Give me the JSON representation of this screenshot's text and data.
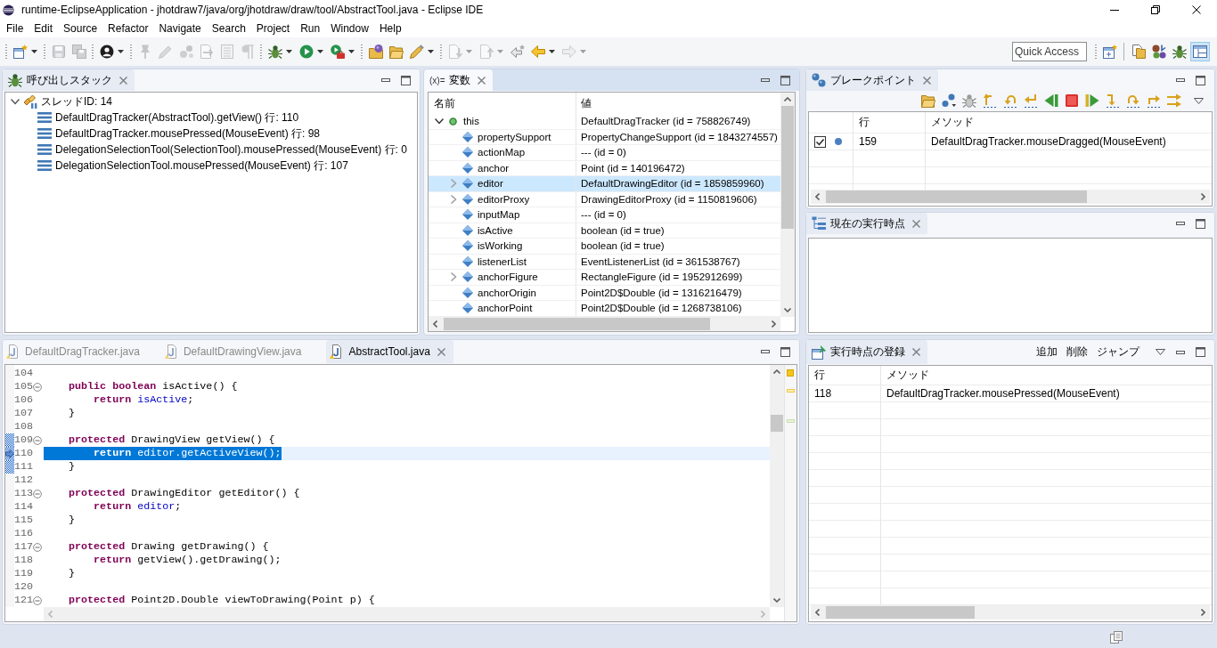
{
  "window": {
    "title": "runtime-EclipseApplication - jhotdraw7/java/org/jhotdraw/draw/tool/AbstractTool.java - Eclipse IDE"
  },
  "menu": [
    "File",
    "Edit",
    "Source",
    "Refactor",
    "Navigate",
    "Search",
    "Project",
    "Run",
    "Window",
    "Help"
  ],
  "toolbar": {
    "groups": [
      [
        {
          "disabled": false,
          "dropdown": true
        }
      ],
      [
        {
          "disabled": true,
          "dropdown": false
        },
        {
          "disabled": true,
          "dropdown": false
        }
      ],
      [
        {
          "disabled": false,
          "dropdown": true
        }
      ],
      [
        {
          "disabled": true,
          "dropdown": false
        },
        {
          "disabled": true,
          "dropdown": false
        },
        {
          "disabled": true,
          "dropdown": false
        },
        {
          "disabled": true,
          "dropdown": false
        },
        {
          "disabled": true,
          "dropdown": false
        },
        {
          "disabled": true,
          "dropdown": false
        }
      ],
      [
        {
          "disabled": false,
          "dropdown": true
        },
        {
          "disabled": false,
          "dropdown": true
        },
        {
          "disabled": false,
          "dropdown": true
        }
      ],
      [
        {
          "disabled": false,
          "dropdown": false
        },
        {
          "disabled": false,
          "dropdown": false
        },
        {
          "disabled": false,
          "dropdown": true
        }
      ],
      [
        {
          "disabled": true,
          "dropdown": true
        },
        {
          "disabled": true,
          "dropdown": true
        },
        {
          "disabled": false,
          "dropdown": false
        },
        {
          "disabled": false,
          "dropdown": true
        },
        {
          "disabled": true,
          "dropdown": true
        }
      ]
    ],
    "quick_access": {
      "placeholder": "Quick Access"
    },
    "perspectives": [
      {
        "selected": false
      },
      {
        "selected": false
      },
      {
        "selected": false
      },
      {
        "selected": true
      }
    ]
  },
  "call_stack": {
    "focused": false,
    "tab": {
      "title": "呼び出しスタック"
    },
    "tree": [
      {
        "label": "スレッドID: 14",
        "expanded": true,
        "children": [
          {
            "label": "DefaultDragTracker(AbstractTool).getView() 行: 110"
          },
          {
            "label": "DefaultDragTracker.mousePressed(MouseEvent) 行: 98"
          },
          {
            "label": "DelegationSelectionTool(SelectionTool).mousePressed(MouseEvent) 行: 0"
          },
          {
            "label": "DelegationSelectionTool.mousePressed(MouseEvent) 行: 107"
          }
        ]
      }
    ]
  },
  "variables": {
    "focused": true,
    "tab": {
      "glyph": "(x)=",
      "title": "変数"
    },
    "columns": [
      "名前",
      "値"
    ],
    "rows": [
      {
        "name": "this",
        "value": "DefaultDragTracker (id = 758826749)",
        "kind": "local",
        "expandable": true,
        "expanded": true,
        "selected": false,
        "children": [
          {
            "name": "propertySupport",
            "value": "PropertyChangeSupport (id = 1843274557)",
            "kind": "field",
            "expandable": false,
            "expanded": false,
            "selected": false
          },
          {
            "name": "actionMap",
            "value": "--- (id = 0)",
            "kind": "field",
            "expandable": false,
            "expanded": false,
            "selected": false
          },
          {
            "name": "anchor",
            "value": "Point (id = 140196472)",
            "kind": "field",
            "expandable": false,
            "expanded": false,
            "selected": false
          },
          {
            "name": "editor",
            "value": "DefaultDrawingEditor (id = 1859859960)",
            "kind": "field",
            "expandable": true,
            "expanded": false,
            "selected": true
          },
          {
            "name": "editorProxy",
            "value": "DrawingEditorProxy (id = 1150819606)",
            "kind": "field",
            "expandable": true,
            "expanded": false,
            "selected": false
          },
          {
            "name": "inputMap",
            "value": "--- (id = 0)",
            "kind": "field",
            "expandable": false,
            "expanded": false,
            "selected": false
          },
          {
            "name": "isActive",
            "value": "boolean (id = true)",
            "kind": "field",
            "expandable": false,
            "expanded": false,
            "selected": false
          },
          {
            "name": "isWorking",
            "value": "boolean (id = true)",
            "kind": "field",
            "expandable": false,
            "expanded": false,
            "selected": false
          },
          {
            "name": "listenerList",
            "value": "EventListenerList (id = 361538767)",
            "kind": "field",
            "expandable": false,
            "expanded": false,
            "selected": false
          },
          {
            "name": "anchorFigure",
            "value": "RectangleFigure (id = 1952912699)",
            "kind": "field",
            "expandable": true,
            "expanded": false,
            "selected": false
          },
          {
            "name": "anchorOrigin",
            "value": "Point2D$Double (id = 1316216479)",
            "kind": "field",
            "expandable": false,
            "expanded": false,
            "selected": false
          },
          {
            "name": "anchorPoint",
            "value": "Point2D$Double (id = 1268738106)",
            "kind": "field",
            "expandable": false,
            "expanded": false,
            "selected": false
          }
        ]
      }
    ]
  },
  "breakpoints": {
    "focused": false,
    "tab": {
      "title": "ブレークポイント"
    },
    "columns": [
      "行",
      "メソッド"
    ],
    "rows": [
      {
        "checked": true,
        "line": "159",
        "method": "DefaultDragTracker.mouseDragged(MouseEvent)"
      }
    ]
  },
  "current_point": {
    "focused": false,
    "tab": {
      "title": "現在の実行時点"
    }
  },
  "editor": {
    "focused": false,
    "tabs": [
      {
        "label": "DefaultDragTracker.java",
        "selected": false
      },
      {
        "label": "DefaultDrawingView.java",
        "selected": false
      },
      {
        "label": "AbstractTool.java",
        "selected": true
      }
    ],
    "lines": [
      {
        "number": "104",
        "fold": false,
        "in_range": false,
        "current": false,
        "selected": false
      },
      {
        "number": "105",
        "fold": true,
        "in_range": false,
        "current": false,
        "selected": false,
        "tokens": [
          {
            "text": "public ",
            "kind": "keyword"
          },
          {
            "text": "boolean",
            "kind": "keyword"
          },
          {
            "text": " isActive() {",
            "kind": "plain"
          }
        ],
        "children": [
          {
            "number": "106",
            "fold": false,
            "in_range": false,
            "current": false,
            "selected": false,
            "tokens": [
              {
                "text": "return ",
                "kind": "keyword"
              },
              {
                "text": "isActive",
                "kind": "field"
              },
              {
                "text": ";",
                "kind": "plain"
              }
            ]
          }
        ]
      },
      {
        "number": "107",
        "fold": false,
        "in_range": false,
        "current": false,
        "selected": false,
        "tokens": [
          {
            "text": "}",
            "kind": "plain"
          }
        ]
      },
      {
        "number": "108",
        "fold": false,
        "in_range": false,
        "current": false,
        "selected": false
      },
      {
        "number": "109",
        "fold": true,
        "in_range": true,
        "current": false,
        "selected": false,
        "tokens": [
          {
            "text": "protected",
            "kind": "keyword"
          },
          {
            "text": " DrawingView getView() {",
            "kind": "plain"
          }
        ],
        "children": [
          {
            "number": "110",
            "fold": false,
            "in_range": true,
            "current": true,
            "selected": true,
            "tokens": [
              {
                "text": "return ",
                "kind": "keyword"
              },
              {
                "text": "editor",
                "kind": "field"
              },
              {
                "text": ".getActiveView();",
                "kind": "plain"
              }
            ]
          }
        ]
      },
      {
        "number": "111",
        "fold": false,
        "in_range": true,
        "current": false,
        "selected": false,
        "tokens": [
          {
            "text": "}",
            "kind": "plain"
          }
        ]
      },
      {
        "number": "112",
        "fold": false,
        "in_range": false,
        "current": false,
        "selected": false
      },
      {
        "number": "113",
        "fold": true,
        "in_range": false,
        "current": false,
        "selected": false,
        "tokens": [
          {
            "text": "protected",
            "kind": "keyword"
          },
          {
            "text": " DrawingEditor getEditor() {",
            "kind": "plain"
          }
        ],
        "children": [
          {
            "number": "114",
            "fold": false,
            "in_range": false,
            "current": false,
            "selected": false,
            "tokens": [
              {
                "text": "return ",
                "kind": "keyword"
              },
              {
                "text": "editor",
                "kind": "field"
              },
              {
                "text": ";",
                "kind": "plain"
              }
            ]
          }
        ]
      },
      {
        "number": "115",
        "fold": false,
        "in_range": false,
        "current": false,
        "selected": false,
        "tokens": [
          {
            "text": "}",
            "kind": "plain"
          }
        ]
      },
      {
        "number": "116",
        "fold": false,
        "in_range": false,
        "current": false,
        "selected": false
      },
      {
        "number": "117",
        "fold": true,
        "in_range": false,
        "current": false,
        "selected": false,
        "tokens": [
          {
            "text": "protected",
            "kind": "keyword"
          },
          {
            "text": " Drawing getDrawing() {",
            "kind": "plain"
          }
        ],
        "children": [
          {
            "number": "118",
            "fold": false,
            "in_range": false,
            "current": false,
            "selected": false,
            "tokens": [
              {
                "text": "return ",
                "kind": "keyword"
              },
              {
                "text": "getView().getDrawing();",
                "kind": "plain"
              }
            ]
          }
        ]
      },
      {
        "number": "119",
        "fold": false,
        "in_range": false,
        "current": false,
        "selected": false,
        "tokens": [
          {
            "text": "}",
            "kind": "plain"
          }
        ]
      },
      {
        "number": "120",
        "fold": false,
        "in_range": false,
        "current": false,
        "selected": false
      },
      {
        "number": "121",
        "fold": true,
        "in_range": false,
        "current": false,
        "selected": false,
        "tokens": [
          {
            "text": "protected",
            "kind": "keyword"
          },
          {
            "text": " Point2D.Double viewToDrawing(Point p) {",
            "kind": "plain"
          }
        ]
      }
    ]
  },
  "registry": {
    "focused": false,
    "tab": {
      "title": "実行時点の登録"
    },
    "actions": [
      "追加",
      "削除",
      "ジャンプ"
    ],
    "columns": [
      "行",
      "メソッド"
    ],
    "rows": [
      {
        "line": "118",
        "method": "DefaultDragTracker.mousePressed(MouseEvent)"
      }
    ]
  }
}
